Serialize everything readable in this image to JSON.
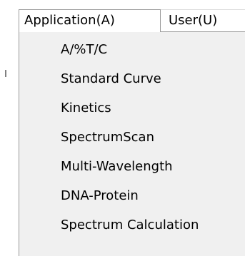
{
  "menubar": {
    "items": [
      {
        "label": "Application(A)"
      },
      {
        "label": "User(U)"
      }
    ]
  },
  "application_menu": {
    "items": [
      {
        "label": "A/%T/C"
      },
      {
        "label": "Standard Curve"
      },
      {
        "label": "Kinetics"
      },
      {
        "label": "SpectrumScan"
      },
      {
        "label": "Multi-Wavelength"
      },
      {
        "label": "DNA-Protein"
      },
      {
        "label": "Spectrum Calculation"
      }
    ]
  },
  "colors": {
    "menu_background": "#f0f0f0",
    "menu_border": "#9a9a9a",
    "text": "#000000"
  }
}
